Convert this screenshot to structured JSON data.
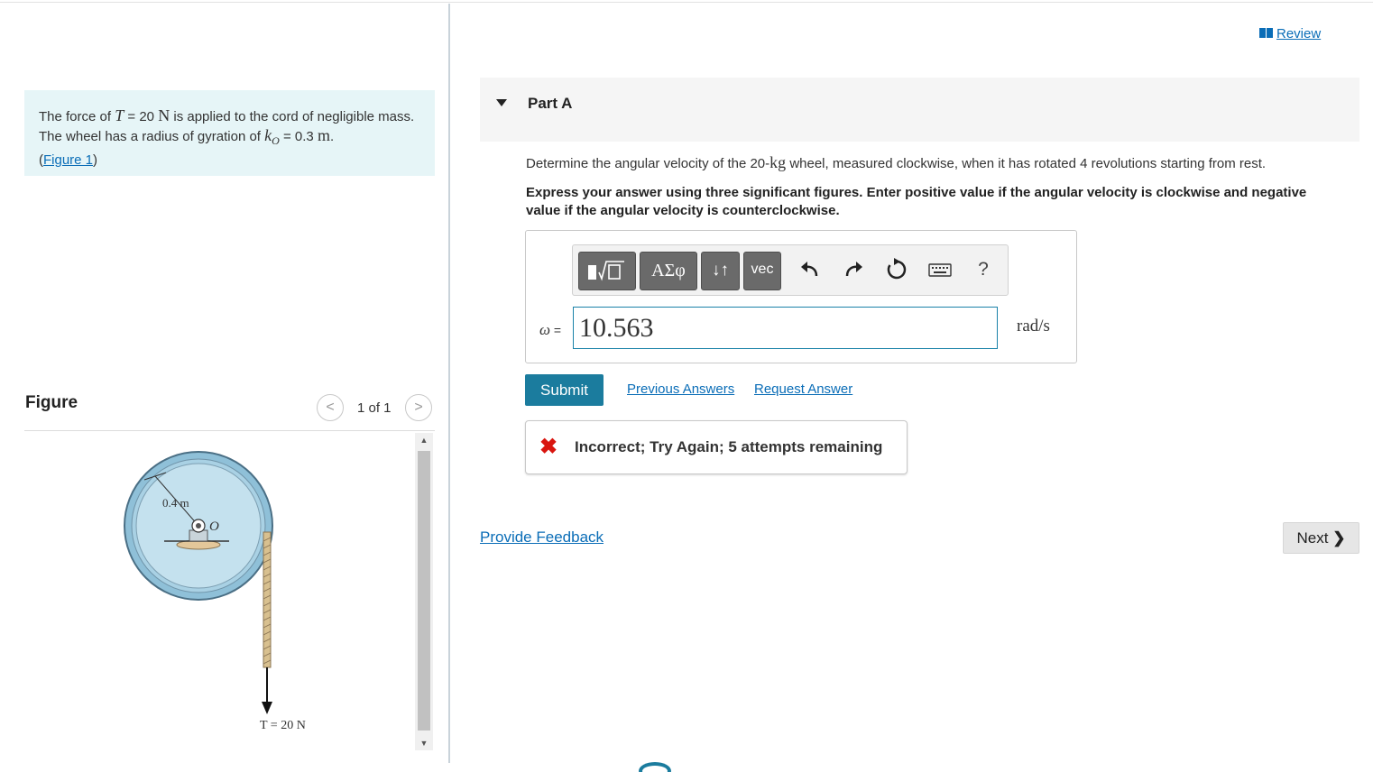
{
  "header": {
    "review_label": "Review"
  },
  "problem": {
    "text_1": "The force of ",
    "T_symbol": "T",
    "text_2": " = 20 ",
    "unit_N": "N",
    "text_3": " is applied to the cord of negligible mass. The wheel has a radius of gyration of ",
    "k_symbol": "k",
    "k_sub": "O",
    "text_4": " = 0.3 ",
    "unit_m": "m",
    "text_5": ".",
    "figure_link_open": "(",
    "figure_link": "Figure 1",
    "figure_link_close": ")"
  },
  "figure": {
    "title": "Figure",
    "pager": "1 of 1",
    "prev_symbol": "<",
    "next_symbol": ">",
    "label_radius": "0.4 m",
    "label_O": "O",
    "label_T": "T = 20 N"
  },
  "part": {
    "title": "Part A",
    "question_1": "Determine the angular velocity of the 20-",
    "question_unit": "kg",
    "question_2": " wheel, measured clockwise, when it has rotated 4 revolutions starting from rest.",
    "instructions": "Express your answer using three significant figures. Enter positive value if the angular velocity is clockwise and negative value if the angular velocity is counterclockwise."
  },
  "toolbar": {
    "greek_label": "ΑΣφ",
    "arrows_label": "↓↑",
    "vec_label": "vec",
    "help_label": "?"
  },
  "answer": {
    "variable": "ω",
    "equals": "=",
    "value": "10.563",
    "unit": "rad/s"
  },
  "actions": {
    "submit": "Submit",
    "previous_answers": "Previous Answers",
    "request_answer": "Request Answer"
  },
  "feedback": {
    "icon": "✖",
    "message": "Incorrect; Try Again; 5 attempts remaining"
  },
  "footer": {
    "provide_feedback": "Provide Feedback",
    "next": "Next"
  },
  "colors": {
    "accent": "#1b7c9e",
    "link": "#0a6db7",
    "error": "#d9150f",
    "problem_bg": "#e6f5f7"
  }
}
